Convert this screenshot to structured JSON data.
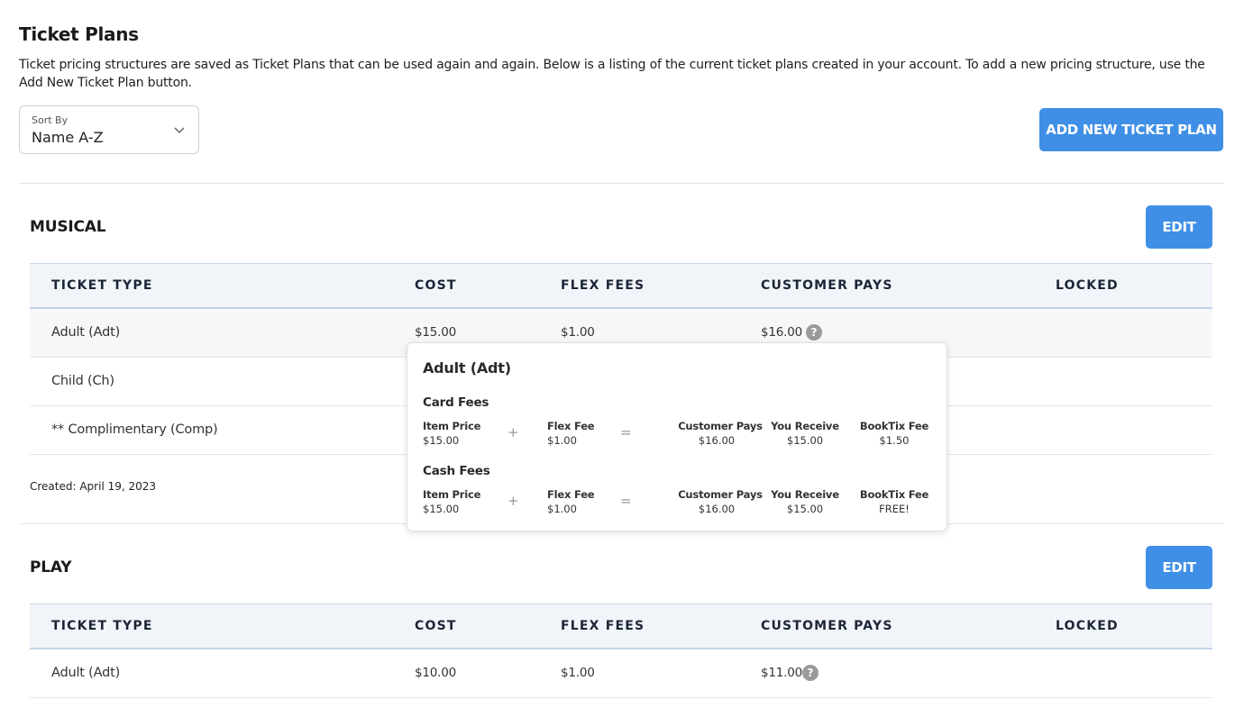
{
  "page": {
    "title": "Ticket Plans",
    "description": "Ticket pricing structures are saved as Ticket Plans that can be used again and again. Below is a listing of the current ticket plans created in your account. To add a new pricing structure, use the Add New Ticket Plan button."
  },
  "sort": {
    "label": "Sort By",
    "value": "Name A-Z"
  },
  "add_button": "ADD NEW TICKET PLAN",
  "columns": [
    "TICKET TYPE",
    "COST",
    "FLEX FEES",
    "CUSTOMER PAYS",
    "LOCKED"
  ],
  "plans": [
    {
      "name": "MUSICAL",
      "edit": "EDIT",
      "rows": [
        {
          "type": "Adult (Adt)",
          "cost": "$15.00",
          "flex": "$1.00",
          "customer_pays": "$16.00",
          "locked": ""
        },
        {
          "type": "Child (Ch)",
          "cost": "",
          "flex": "",
          "customer_pays": "",
          "locked": ""
        },
        {
          "type": "** Complimentary (Comp)",
          "cost": "",
          "flex": "",
          "customer_pays": "",
          "locked": ""
        }
      ],
      "created": "Created: April 19, 2023"
    },
    {
      "name": "PLAY",
      "edit": "EDIT",
      "rows": [
        {
          "type": "Adult (Adt)",
          "cost": "$10.00",
          "flex": "$1.00",
          "customer_pays": "$11.00",
          "locked": ""
        }
      ]
    }
  ],
  "popover": {
    "title": "Adult (Adt)",
    "sections": [
      {
        "name": "Card Fees",
        "item_price_label": "Item Price",
        "item_price": "$15.00",
        "plus": "+",
        "flex_label": "Flex Fee",
        "flex": "$1.00",
        "equals": "=",
        "customer_label": "Customer Pays",
        "customer": "$16.00",
        "receive_label": "You Receive",
        "receive": "$15.00",
        "booktix_label": "BookTix Fee",
        "booktix": "$1.50"
      },
      {
        "name": "Cash Fees",
        "item_price_label": "Item Price",
        "item_price": "$15.00",
        "plus": "+",
        "flex_label": "Flex Fee",
        "flex": "$1.00",
        "equals": "=",
        "customer_label": "Customer Pays",
        "customer": "$16.00",
        "receive_label": "You Receive",
        "receive": "$15.00",
        "booktix_label": "BookTix Fee",
        "booktix": "FREE!"
      }
    ]
  },
  "icons": {
    "sort": "chevron-down-icon",
    "help": "question-circle-icon"
  },
  "colors": {
    "primary": "#3f8fe6",
    "header_bg": "#f1f5fa"
  }
}
